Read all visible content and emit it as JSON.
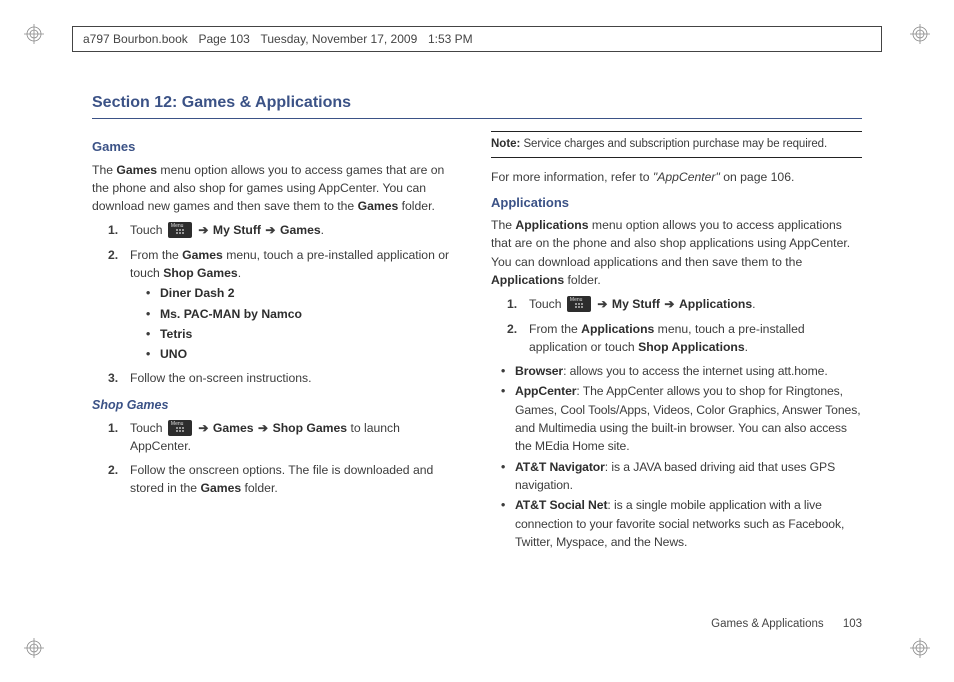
{
  "print_header": {
    "file": "a797 Bourbon.book",
    "page_label": "Page 103",
    "day_date": "Tuesday, November 17, 2009",
    "time": "1:53 PM"
  },
  "section_title": "Section 12: Games & Applications",
  "left": {
    "h_games": "Games",
    "games_intro_1": "The ",
    "games_intro_b1": "Games",
    "games_intro_2": " menu option allows you to access games that are on the phone and also shop for games using AppCenter. You can download new games and then save them to the ",
    "games_intro_b2": "Games",
    "games_intro_3": " folder.",
    "step1_a": "Touch ",
    "step1_b": "My Stuff",
    "step1_c": "Games",
    "step2_a": "From the ",
    "step2_b": "Games",
    "step2_c": " menu, touch a pre-installed application or touch ",
    "step2_d": "Shop Games",
    "step2_e": ".",
    "bul1": "Diner Dash 2",
    "bul2": "Ms. PAC-MAN by Namco",
    "bul3": "Tetris",
    "bul4": "UNO",
    "step3": " Follow the on-screen instructions.",
    "h_shop": "Shop Games",
    "sg1_a": "Touch ",
    "sg1_b": "Games",
    "sg1_c": "Shop Games",
    "sg1_d": " to launch AppCenter.",
    "sg2_a": "Follow the onscreen options. The file is downloaded and stored in the ",
    "sg2_b": "Games",
    "sg2_c": " folder."
  },
  "right": {
    "note_b": "Note:",
    "note_t": " Service charges and subscription purchase may be required.",
    "more_a": "For more information, refer to ",
    "more_i": "\"AppCenter\"",
    "more_b": "  on page 106.",
    "h_apps": "Applications",
    "apps_intro_1": "The ",
    "apps_intro_b1": "Applications",
    "apps_intro_2": " menu option allows you to access applications that are on the phone and also shop applications using AppCenter. You can download applications and then save them to the ",
    "apps_intro_b2": "Applications",
    "apps_intro_3": " folder.",
    "a1_a": "Touch ",
    "a1_b": "My Stuff",
    "a1_c": "Applications",
    "a2_a": "From the ",
    "a2_b": "Applications",
    "a2_c": " menu, touch a pre-installed application or touch ",
    "a2_d": "Shop Applications",
    "a2_e": ".",
    "b1_b": "Browser",
    "b1_t": ": allows you to access the internet using att.home.",
    "b2_b": "AppCenter",
    "b2_t": ": The AppCenter allows you to shop for Ringtones, Games, Cool Tools/Apps, Videos, Color Graphics, Answer Tones, and Multimedia using the built-in browser. You can also access the MEdia Home site.",
    "b3_b": "AT&T Navigator",
    "b3_t": ": is a JAVA based driving aid that uses GPS navigation.",
    "b4_b": "AT&T Social Net",
    "b4_t": ": is a single mobile application with a live connection to your favorite social networks such as Facebook, Twitter, Myspace, and the News."
  },
  "footer": {
    "section": "Games & Applications",
    "page": "103"
  }
}
